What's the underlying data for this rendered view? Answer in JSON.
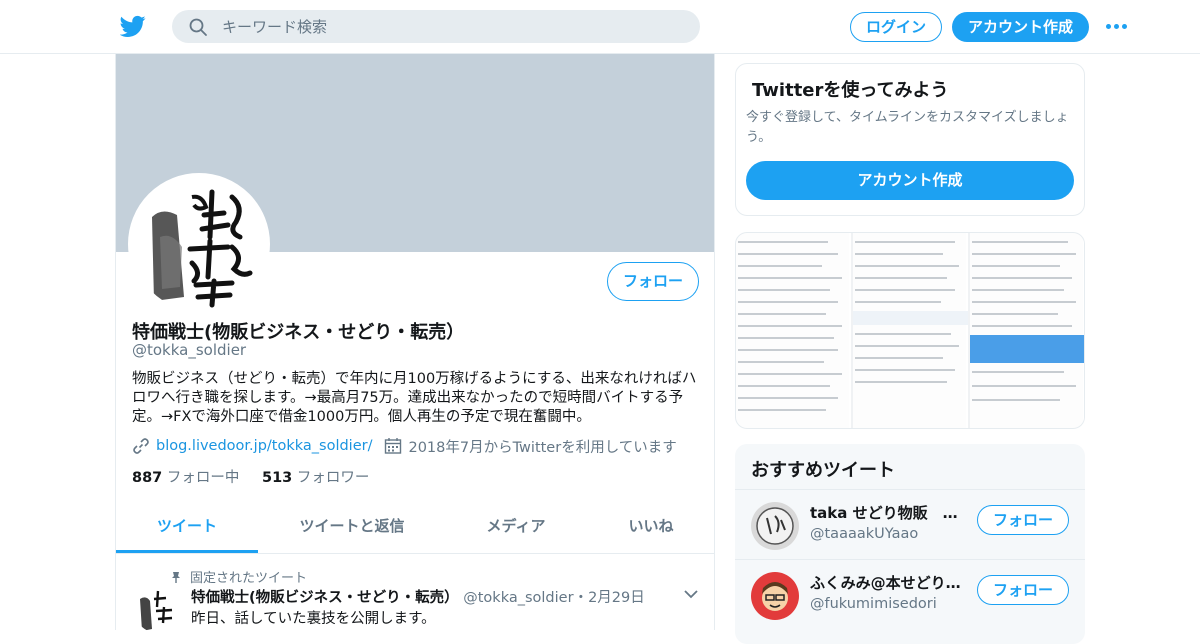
{
  "topbar": {
    "search_placeholder": "キーワード検索",
    "login_label": "ログイン",
    "signup_label": "アカウント作成",
    "brand_color": "#1da1f2"
  },
  "profile": {
    "name": "特価戦士(物販ビジネス・せどり・転売）",
    "handle": "@tokka_soldier",
    "follow_label": "フォロー",
    "bio": "物販ビジネス（せどり・転売）で年内に月100万稼げるようにする、出来なれければハロワへ行き職を探します。→最高月75万。達成出来なかったので短時間バイトする予定。→FXで海外口座で借金1000万円。個人再生の予定で現在奮闘中。",
    "website": "blog.livedoor.jp/tokka_soldier/",
    "joined": "2018年7月からTwitterを利用しています",
    "following_count": "887",
    "following_label": "フォロー中",
    "followers_count": "513",
    "followers_label": "フォロワー"
  },
  "tabs": [
    {
      "label": "ツイート",
      "active": true
    },
    {
      "label": "ツイートと返信",
      "active": false
    },
    {
      "label": "メディア",
      "active": false
    },
    {
      "label": "いいね",
      "active": false
    }
  ],
  "pinned_tweet": {
    "pinned_label": "固定されたツイート",
    "author": "特価戦士(物販ビジネス・せどり・転売）",
    "handle": "@tokka_soldier",
    "separator": "・",
    "date": "2月29日",
    "text": "昨日、話していた裏技を公開します。"
  },
  "sidebar": {
    "signup_card": {
      "title": "Twitterを使ってみよう",
      "description": "今すぐ登録して、タイムラインをカスタマイズしましょう。",
      "button": "アカウント作成"
    },
    "recommended": {
      "title": "おすすめツイート",
      "users": [
        {
          "name": "taka せどり物販　飲食店経営",
          "handle": "@taaaakUYaao",
          "follow": "フォロー"
        },
        {
          "name": "ふくみみ@本せどり専門",
          "handle": "@fukumimisedori",
          "follow": "フォロー"
        }
      ]
    }
  }
}
